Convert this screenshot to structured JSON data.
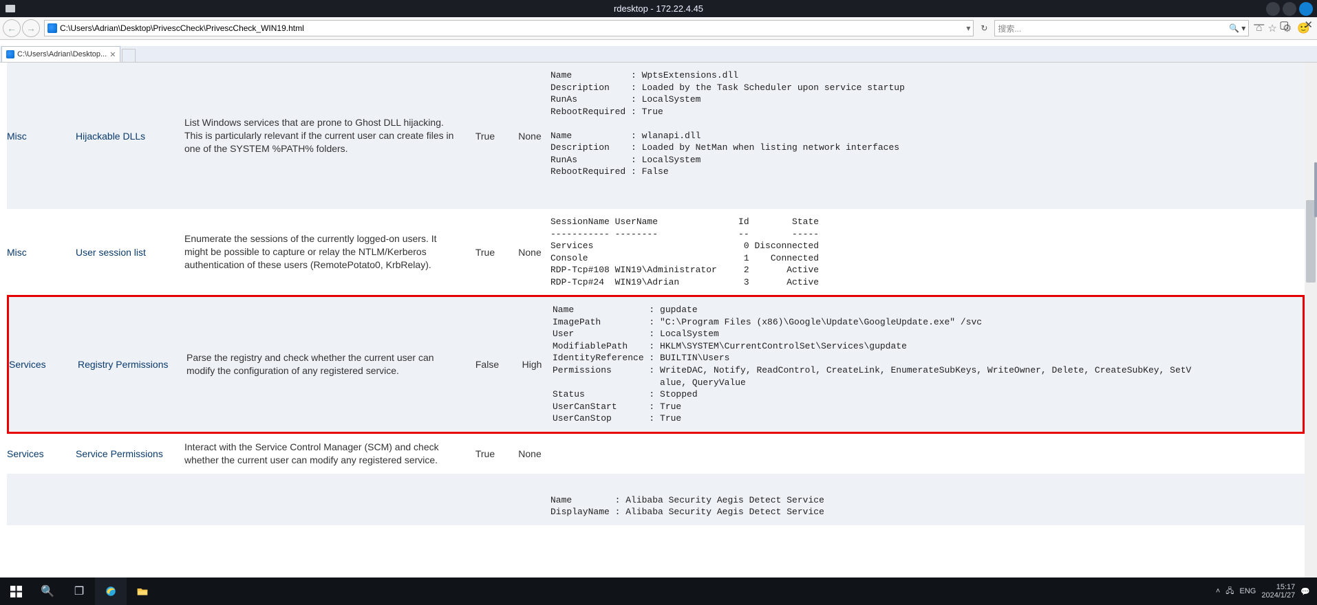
{
  "rdesktop": {
    "title": "rdesktop - 172.22.4.45"
  },
  "ie": {
    "url": "C:\\Users\\Adrian\\Desktop\\PrivescCheck\\PrivescCheck_WIN19.html",
    "search_placeholder": "搜索...",
    "tab_label": "C:\\Users\\Adrian\\Desktop..."
  },
  "rows": [
    {
      "cat": "Misc",
      "name": "Hijackable DLLs",
      "desc": "List Windows services that are prone to Ghost DLL hijacking. This is particularly relevant if the current user can create files in one of the SYSTEM %PATH% folders.",
      "compliant": "True",
      "severity": "None",
      "out": "Name           : WptsExtensions.dll\nDescription    : Loaded by the Task Scheduler upon service startup\nRunAs          : LocalSystem\nRebootRequired : True\n\nName           : wlanapi.dll\nDescription    : Loaded by NetMan when listing network interfaces\nRunAs          : LocalSystem\nRebootRequired : False\n\n\n"
    },
    {
      "cat": "Misc",
      "name": "User session list",
      "desc": "Enumerate the sessions of the currently logged-on users. It might be possible to capture or relay the NTLM/Kerberos authentication of these users (RemotePotato0, KrbRelay).",
      "compliant": "True",
      "severity": "None",
      "out": "SessionName UserName               Id        State\n----------- --------               --        -----\nServices                            0 Disconnected\nConsole                             1    Connected\nRDP-Tcp#108 WIN19\\Administrator     2       Active\nRDP-Tcp#24  WIN19\\Adrian            3       Active\n"
    },
    {
      "cat": "Services",
      "name": "Registry Permissions",
      "desc": "Parse the registry and check whether the current user can modify the configuration of any registered service.",
      "compliant": "False",
      "severity": "High",
      "out": "Name              : gupdate\nImagePath         : \"C:\\Program Files (x86)\\Google\\Update\\GoogleUpdate.exe\" /svc\nUser              : LocalSystem\nModifiablePath    : HKLM\\SYSTEM\\CurrentControlSet\\Services\\gupdate\nIdentityReference : BUILTIN\\Users\nPermissions       : WriteDAC, Notify, ReadControl, CreateLink, EnumerateSubKeys, WriteOwner, Delete, CreateSubKey, SetV\n                    alue, QueryValue\nStatus            : Stopped\nUserCanStart      : True\nUserCanStop       : True\n"
    },
    {
      "cat": "Services",
      "name": "Service Permissions",
      "desc": "Interact with the Service Control Manager (SCM) and check whether the current user can modify any registered service.",
      "compliant": "True",
      "severity": "None",
      "out": ""
    },
    {
      "cat": "",
      "name": "",
      "desc": "",
      "compliant": "",
      "severity": "",
      "out": "Name        : Alibaba Security Aegis Detect Service\nDisplayName : Alibaba Security Aegis Detect Service"
    }
  ],
  "tray": {
    "ime": "ENG",
    "time": "15:17",
    "date": "2024/1/27"
  }
}
